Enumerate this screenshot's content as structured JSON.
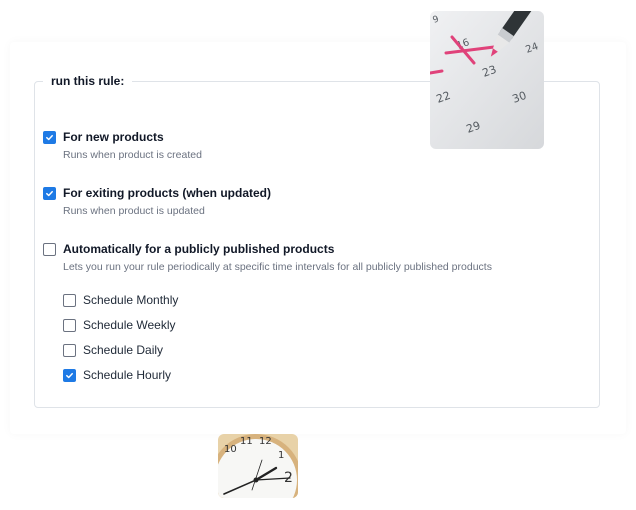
{
  "legend": "run this rule:",
  "options": [
    {
      "label": "For new products",
      "checked": true,
      "description": "Runs when product is created"
    },
    {
      "label": "For exiting products (when updated)",
      "checked": true,
      "description": "Runs when product is updated"
    },
    {
      "label": "Automatically for a publicly published products",
      "checked": false,
      "description": "Lets you run your rule periodically at specific time intervals for all publicly published products"
    }
  ],
  "schedules": [
    {
      "label": "Schedule Monthly",
      "checked": false
    },
    {
      "label": "Schedule Weekly",
      "checked": false
    },
    {
      "label": "Schedule Daily",
      "checked": false
    },
    {
      "label": "Schedule Hourly",
      "checked": true
    }
  ],
  "calendar_photo": {
    "numbers": [
      "9",
      "16",
      "24",
      "23",
      "22",
      "30",
      "29"
    ]
  },
  "clock_photo": {
    "numbers": [
      "10",
      "11",
      "12",
      "1",
      "2"
    ]
  },
  "colors": {
    "accent": "#1e7ae5",
    "border": "#dfe3e8",
    "muted_text": "#6b7280"
  }
}
